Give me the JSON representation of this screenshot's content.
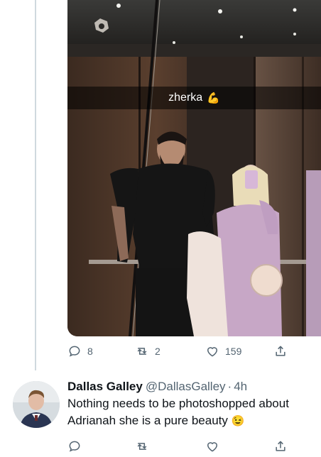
{
  "tweet1": {
    "media": {
      "caption": "zherka",
      "caption_emoji": "💪"
    },
    "actions": {
      "replies": "8",
      "retweets": "2",
      "likes": "159"
    }
  },
  "tweet2": {
    "author_name": "Dallas Galley",
    "author_handle": "@DallasGalley",
    "separator": "·",
    "time": "4h",
    "text_line1": "Nothing needs to be photoshopped about",
    "text_line2": "Adrianah she is a pure beauty",
    "text_emoji": "😉"
  },
  "colors": {
    "text": "#0f1419",
    "muted": "#536471",
    "thread_line": "#cfd9de"
  },
  "icons": {
    "reply": "reply-icon",
    "retweet": "retweet-icon",
    "like": "like-icon",
    "share": "share-icon"
  }
}
